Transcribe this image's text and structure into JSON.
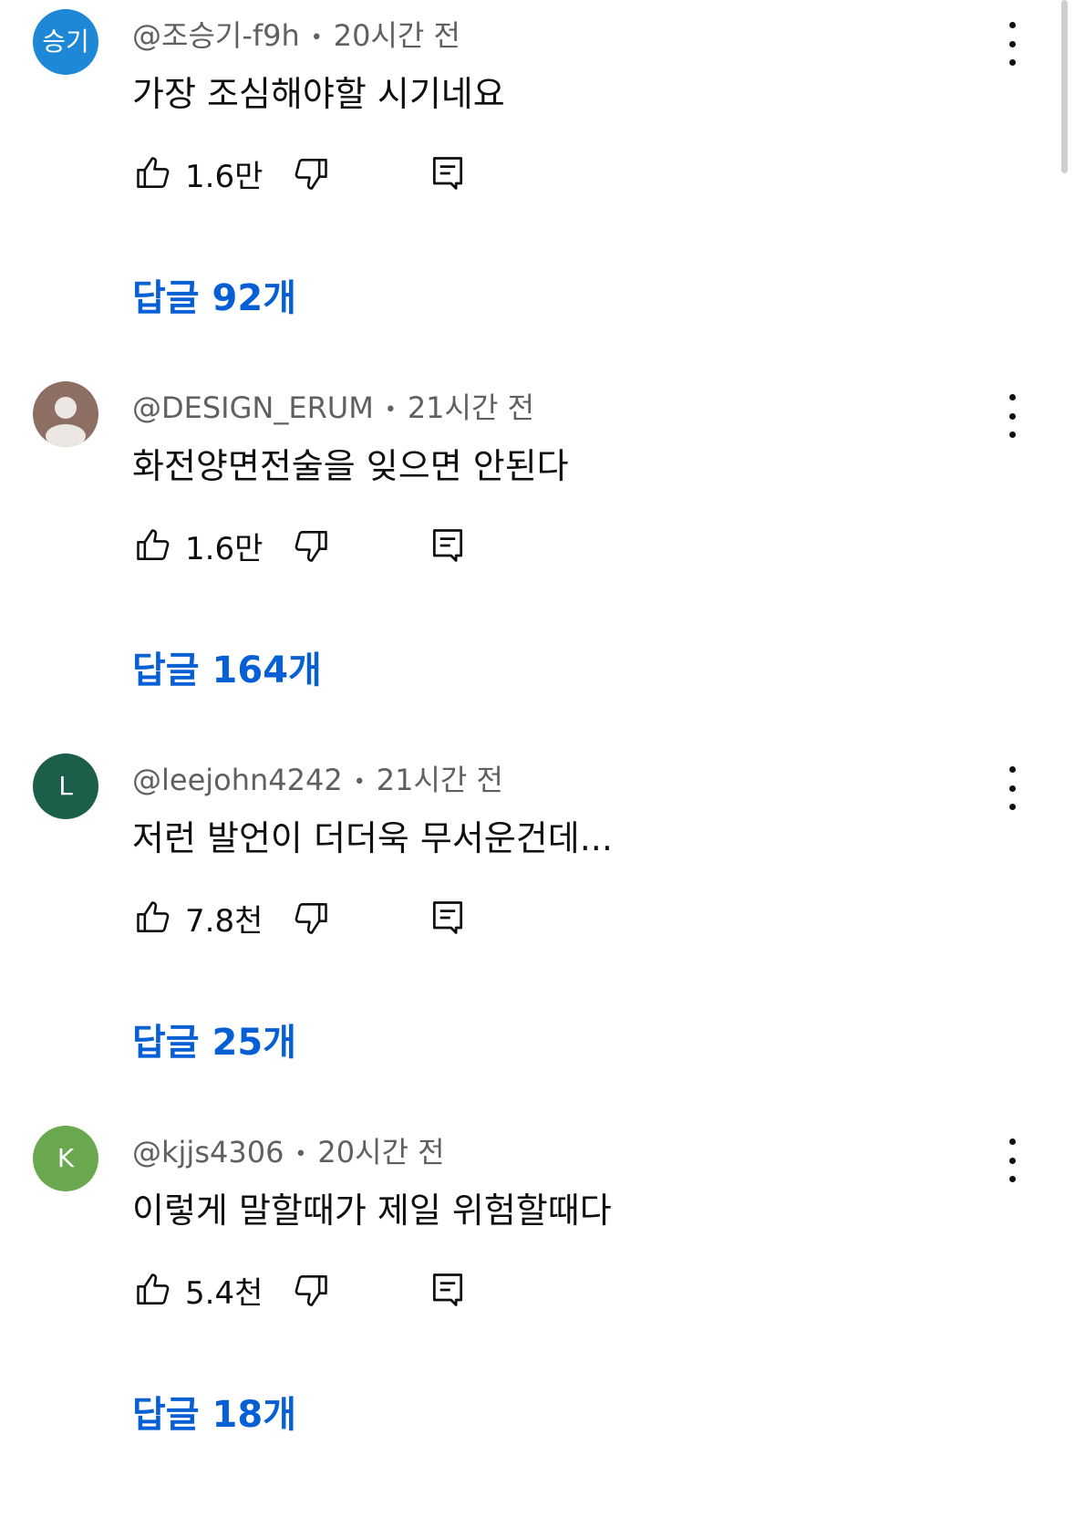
{
  "comments": [
    {
      "avatar_text": "승기",
      "avatar_color": "#1e88d6",
      "author": "@조승기-f9h",
      "time": "20시간 전",
      "text": "가장 조심해야할 시기네요",
      "likes": "1.6만",
      "replies": "답글 92개"
    },
    {
      "avatar_text": "",
      "avatar_color": "#8d6e63",
      "author": "@DESIGN_ERUM",
      "time": "21시간 전",
      "text": "화전양면전술을 잊으면 안된다",
      "likes": "1.6만",
      "replies": "답글 164개"
    },
    {
      "avatar_text": "L",
      "avatar_color": "#1b5e4a",
      "author": "@leejohn4242",
      "time": "21시간 전",
      "text": "저런 발언이 더더욱 무서운건데...",
      "likes": "7.8천",
      "replies": "답글 25개"
    },
    {
      "avatar_text": "K",
      "avatar_color": "#6aa84f",
      "author": "@kjjs4306",
      "time": "20시간 전",
      "text": "이렇게 말할때가 제일 위험할때다",
      "likes": "5.4천",
      "replies": "답글 18개"
    }
  ],
  "separator": "•",
  "icons": {
    "like": "thumbs-up-icon",
    "dislike": "thumbs-down-icon",
    "reply": "comment-icon",
    "menu": "more-vert-icon"
  }
}
